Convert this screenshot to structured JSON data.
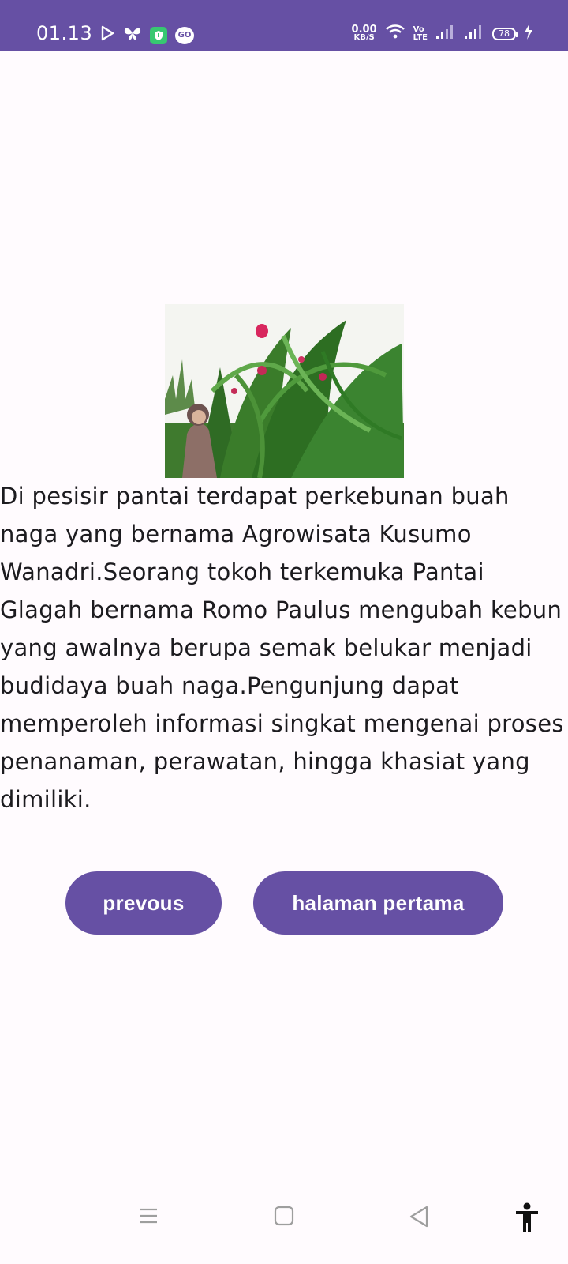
{
  "status_bar": {
    "time": "01.13",
    "net_speed_value": "0.00",
    "net_speed_unit": "KB/S",
    "volte_top": "Vo",
    "volte_bottom": "LTE",
    "battery_level": "78",
    "icons": [
      "play-icon",
      "butterfly-icon",
      "shield-app-icon",
      "go-icon",
      "wifi-icon",
      "signal-icon",
      "signal-icon",
      "charging-icon"
    ]
  },
  "story": {
    "image_alt": "dragon fruit plantation",
    "text": "Di pesisir pantai terdapat perkebunan buah naga yang bernama Agrowisata Kusumo Wanadri.Seorang tokoh terkemuka Pantai Glagah bernama Romo Paulus mengubah kebun yang awalnya berupa semak belukar menjadi budidaya buah naga.Pengunjung dapat memperoleh informasi singkat mengenai proses penanaman, perawatan, hingga khasiat yang dimiliki."
  },
  "buttons": {
    "previous_label": "prevous",
    "first_page_label": "halaman pertama"
  },
  "nav": {
    "icons": [
      "menu-icon",
      "home-icon",
      "back-icon",
      "accessibility-icon"
    ]
  },
  "colors": {
    "primary": "#6650a4",
    "background": "#fffbfe",
    "text": "#1c1b1f"
  }
}
